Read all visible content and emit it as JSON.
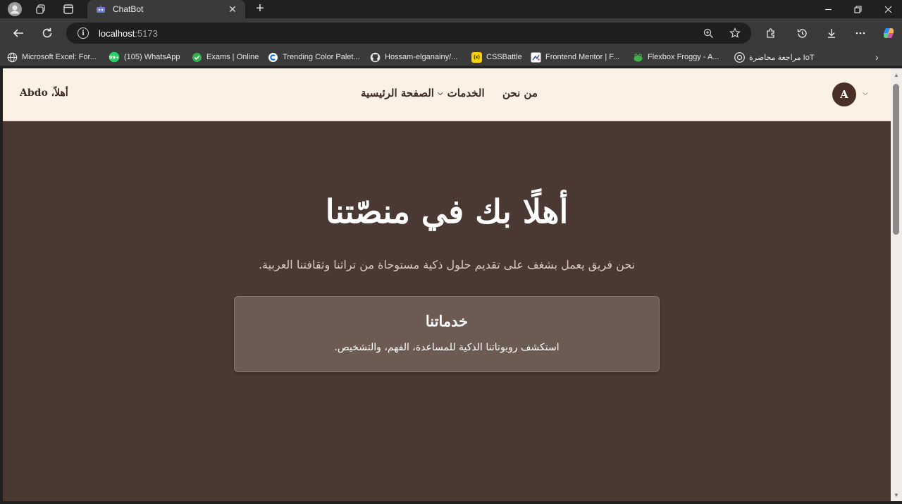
{
  "browser": {
    "tab": {
      "title": "ChatBot"
    },
    "url": {
      "host": "localhost",
      "port": ":5173"
    },
    "bookmarks": [
      {
        "label": "Microsoft Excel: For...",
        "icon": "globe-icon"
      },
      {
        "label": "(105) WhatsApp",
        "icon": "whatsapp-icon",
        "badge": "99+"
      },
      {
        "label": "Exams | Online",
        "icon": "check-circle-icon"
      },
      {
        "label": "Trending Color Palet...",
        "icon": "coolors-icon"
      },
      {
        "label": "Hossam-elganainy/...",
        "icon": "github-icon"
      },
      {
        "label": "CSSBattle",
        "icon": "cssbattle-icon",
        "badge": "(x)"
      },
      {
        "label": "Frontend Mentor | F...",
        "icon": "frontend-mentor-icon"
      },
      {
        "label": "Flexbox Froggy - A...",
        "icon": "frog-icon"
      },
      {
        "label": "مراجعة محاضرة IoT",
        "icon": "chatgpt-icon"
      }
    ],
    "colors": {
      "chrome_dark": "#202020",
      "chrome": "#3a3a3a",
      "omnibox": "#1f1f1f"
    }
  },
  "site": {
    "header": {
      "greeting": "أهلاً، Abdo",
      "nav": {
        "home": "الصفحة الرئيسية",
        "services": "الخدمات",
        "about": "من نحن"
      },
      "avatar_letter": "A"
    },
    "hero": {
      "title": "أهلًا بك في منصّتنا",
      "subtitle": "نحن فريق يعمل بشغف على تقديم حلول ذكية مستوحاة من تراثنا وثقافتنا العربية."
    },
    "card": {
      "title": "خدماتنا",
      "text": "استكشف روبوتاتنا الذكية للمساعدة، الفهم، والتشخيص."
    },
    "colors": {
      "header_bg": "#fbf2e5",
      "page_bg": "#4a3832",
      "card_bg": "#6b5b52",
      "text_dark": "#3f2b25",
      "avatar_bg": "#4a2f27"
    }
  }
}
